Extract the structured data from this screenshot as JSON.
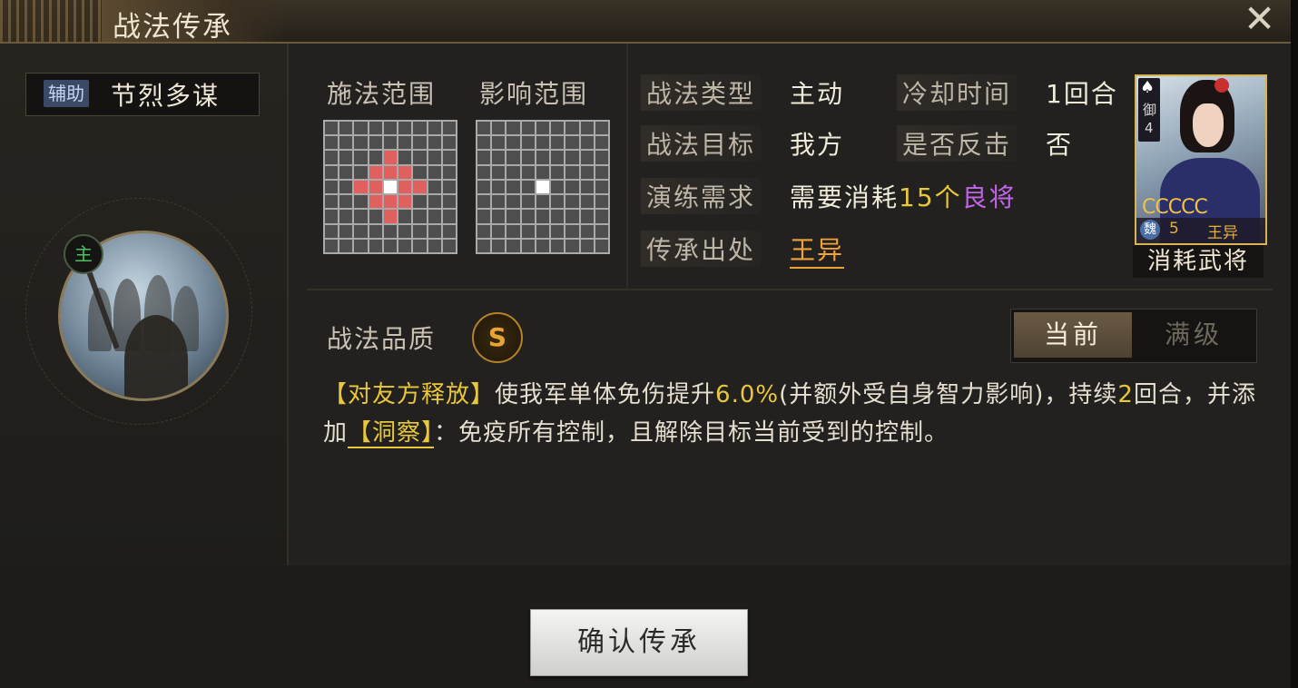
{
  "title": "战法传承",
  "close_icon": "close-icon",
  "skill": {
    "category_tag": "辅助",
    "name": "节烈多谋",
    "main_badge": "主"
  },
  "ranges": {
    "cast_label": "施法范围",
    "effect_label": "影响范围"
  },
  "info": {
    "type_label": "战法类型",
    "type_value": "主动",
    "cooldown_label": "冷却时间",
    "cooldown_value": "1回合",
    "target_label": "战法目标",
    "target_value": "我方",
    "counter_label": "是否反击",
    "counter_value": "否",
    "require_label": "演练需求",
    "require_prefix": "需要消耗",
    "require_count": "15个",
    "require_item": "良将",
    "source_label": "传承出处",
    "source_value": "王异"
  },
  "general_card": {
    "side_mark": "御",
    "side_level": "4",
    "stars": "CCCCC",
    "faction": "魏",
    "cost": "5",
    "name": "王异",
    "caption": "消耗武将"
  },
  "quality": {
    "label": "战法品质",
    "grade": "S"
  },
  "toggle": {
    "current": "当前",
    "max": "满级"
  },
  "description": {
    "part1": "【对友方释放】",
    "part2": "使我军单体免伤提升",
    "percent": "6.0%",
    "part3": "(并额外受自身智力影响)，持续",
    "rounds": "2",
    "part4": "回合，并添加",
    "status": "【洞察】",
    "part5": "：免疫所有控制，且解除目标当前受到的控制。"
  },
  "confirm_button": "确认传承",
  "colors": {
    "highlight_yellow": "#e8c83a",
    "highlight_purple": "#c065e6",
    "source_orange": "#f0a23a",
    "range_red": "#e06060",
    "main_green": "#4cc060"
  }
}
